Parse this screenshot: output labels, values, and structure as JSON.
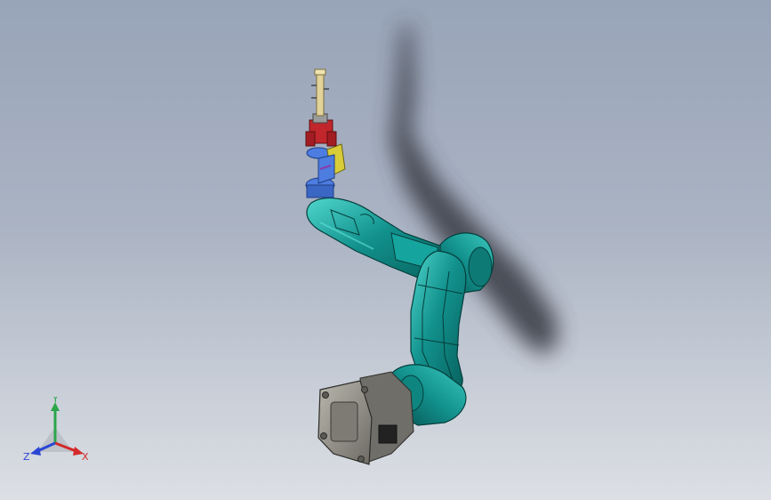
{
  "view": {
    "background_top": "#98a4b8",
    "background_bottom": "#dcdfe4",
    "model_color": "#12918d",
    "model_highlight": "#4fd6cc",
    "model_shadow": "#075e5a",
    "gripper_red": "#c0262b",
    "flange_blue": "#4d7de0",
    "bracket_yellow": "#d8cc3a",
    "motor_gray": "#8e8c84"
  },
  "triad": {
    "y_label": "Y",
    "x_label": "X",
    "z_label": "Z",
    "y_color": "#2aa64a",
    "x_color": "#d32a2a",
    "z_color": "#2a46d3"
  }
}
